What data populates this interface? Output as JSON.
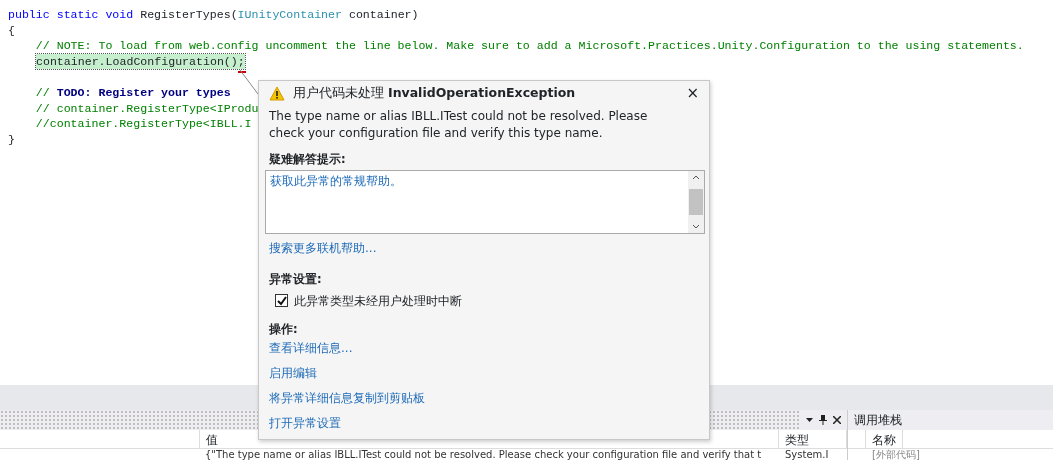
{
  "code_lines": [
    {
      "tokens": [
        {
          "kind": "keyword",
          "text": "public static void"
        },
        {
          "kind": "plain",
          "text": " RegisterTypes("
        },
        {
          "kind": "type",
          "text": "IUnityContainer"
        },
        {
          "kind": "plain",
          "text": " container)"
        }
      ]
    },
    {
      "tokens": [
        {
          "kind": "plain",
          "text": "{"
        }
      ]
    },
    {
      "tokens": [
        {
          "kind": "comment",
          "text": "    // NOTE: To load from web.config uncomment the line below. Make sure to add a Microsoft.Practices.Unity.Configuration to the using statements."
        }
      ]
    },
    {
      "current": true,
      "tokens": [
        {
          "kind": "plain",
          "text": "container.LoadConfiguration();"
        }
      ]
    },
    {
      "gap_before": true,
      "tokens": [
        {
          "kind": "comment",
          "text": "    // "
        },
        {
          "kind": "todo",
          "text": "TODO: Register your types"
        }
      ]
    },
    {
      "tokens": [
        {
          "kind": "comment",
          "text": "    // container.RegisterType<IProdu"
        }
      ]
    },
    {
      "tokens": [
        {
          "kind": "comment",
          "text": "    //container.RegisterType<IBLL.I"
        }
      ]
    },
    {
      "tokens": [
        {
          "kind": "plain",
          "text": "}"
        }
      ]
    }
  ],
  "exception_popup": {
    "title_prefix": "用户代码未处理",
    "title_exception": "InvalidOperationException",
    "close": "×",
    "message": "The type name or alias IBLL.ITest could not be resolved. Please check your configuration file and verify this type name.",
    "tips_heading": "疑难解答提示:",
    "tips": [
      "获取此异常的常规帮助。"
    ],
    "search_link": "搜索更多联机帮助...",
    "settings_heading": "异常设置:",
    "break_option": {
      "label": "此异常类型未经用户处理时中断",
      "checked": true
    },
    "actions_heading": "操作:",
    "actions": [
      "查看详细信息...",
      "启用编辑",
      "将异常详细信息复制到剪贴板",
      "打开异常设置"
    ]
  },
  "locals_panel": {
    "columns": [
      "值",
      "类型"
    ],
    "row": {
      "value": "{\"The type name or alias IBLL.ITest could not be resolved. Please check your configuration file and verify that t",
      "type": "System.I"
    }
  },
  "call_stack_panel": {
    "title": "调用堆栈",
    "columns": [
      "名称"
    ],
    "row": "[外部代码]"
  }
}
